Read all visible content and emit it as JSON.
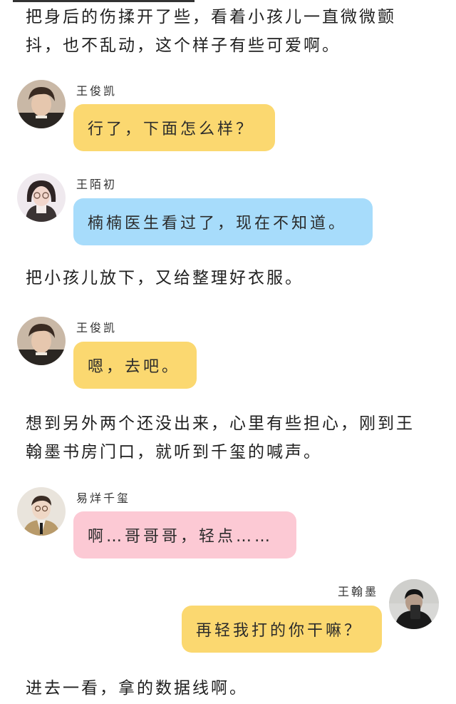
{
  "narration": [
    "把身后的伤揉开了些，看着小孩儿一直微微颤抖，也不乱动，这个样子有些可爱啊。",
    "把小孩儿放下，又给整理好衣服。",
    "想到另外两个还没出来，心里有些担心，刚到王翰墨书房门口，就听到千玺的喊声。",
    "进去一看，拿的数据线啊。"
  ],
  "messages": [
    {
      "speaker": "王俊凯",
      "text": "行了，下面怎么样？",
      "color": "#fbd870"
    },
    {
      "speaker": "王陌初",
      "text": "楠楠医生看过了，现在不知道。",
      "color": "#a7dcfb"
    },
    {
      "speaker": "王俊凯",
      "text": "嗯，去吧。",
      "color": "#fbd870"
    },
    {
      "speaker": "易烊千玺",
      "text": "啊…哥哥哥，轻点……",
      "color": "#fcc9d4"
    },
    {
      "speaker": "王翰墨",
      "text": "再轻我打的你干嘛？",
      "color": "#fbd870"
    }
  ]
}
